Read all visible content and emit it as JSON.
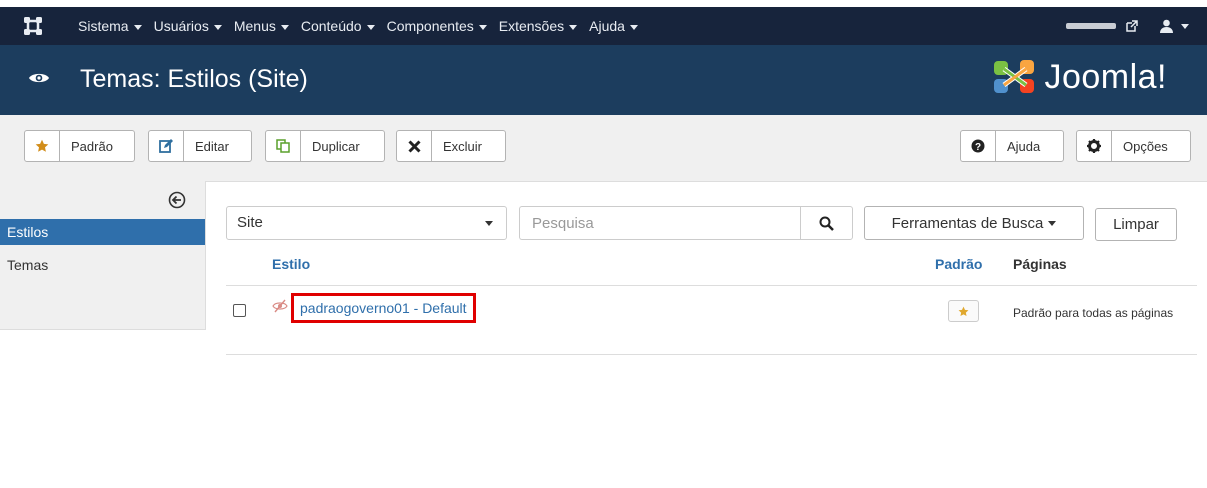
{
  "navbar": {
    "menu": [
      {
        "label": "Sistema"
      },
      {
        "label": "Usuários"
      },
      {
        "label": "Menus"
      },
      {
        "label": "Conteúdo"
      },
      {
        "label": "Componentes"
      },
      {
        "label": "Extensões"
      },
      {
        "label": "Ajuda"
      }
    ],
    "icons": {
      "logo": "joomla-logo-icon",
      "external": "external-link-icon",
      "user": "user-icon"
    }
  },
  "header": {
    "title": "Temas: Estilos (Site)",
    "brand": "Joomla!",
    "icon": "eye-icon"
  },
  "toolbar": {
    "default_label": "Padrão",
    "edit_label": "Editar",
    "duplicate_label": "Duplicar",
    "delete_label": "Excluir",
    "help_label": "Ajuda",
    "options_label": "Opções"
  },
  "sidebar": {
    "items": [
      {
        "label": "Estilos",
        "active": true
      },
      {
        "label": "Temas",
        "active": false
      }
    ]
  },
  "filters": {
    "client_value": "Site",
    "search_placeholder": "Pesquisa",
    "tools_label": "Ferramentas de Busca",
    "clear_label": "Limpar"
  },
  "table": {
    "headers": {
      "style": "Estilo",
      "default": "Padrão",
      "pages": "Páginas"
    },
    "rows": [
      {
        "style": "padraogoverno01 - Default",
        "default": true,
        "pages": "Padrão para todas as páginas"
      }
    ]
  },
  "colors": {
    "navbar": "#17243c",
    "header": "#1c3d5e",
    "link": "#2f6fab",
    "highlight": "#e00000",
    "star": "#e0a82e"
  }
}
